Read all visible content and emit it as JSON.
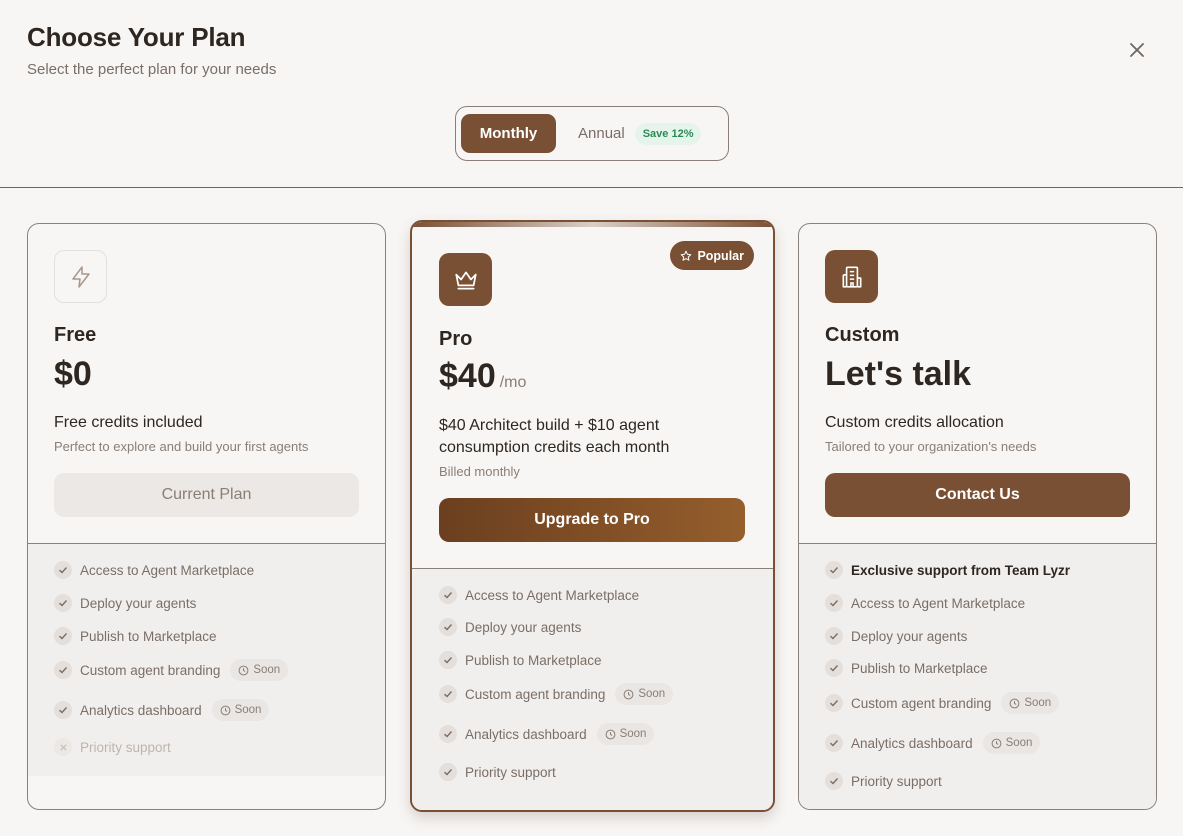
{
  "header": {
    "title": "Choose Your Plan",
    "subtitle": "Select the perfect plan for your needs"
  },
  "icons": {
    "close": "close-icon",
    "free": "lightning-icon",
    "pro": "crown-icon",
    "custom": "building-icon",
    "popular": "star-icon",
    "check": "check-icon",
    "cross": "x-icon",
    "soon": "clock-icon"
  },
  "billing_toggle": {
    "monthly_label": "Monthly",
    "annual_label": "Annual",
    "save_badge": "Save 12%",
    "selected": "Monthly"
  },
  "colors": {
    "accent": "#7a5035",
    "background": "#f8f6f4",
    "save_badge": "#2d8a57"
  },
  "plans": {
    "free": {
      "name": "Free",
      "price": "$0",
      "description": "Free credits included",
      "subtext": "Perfect to explore and build your first agents",
      "cta": "Current Plan",
      "features": [
        {
          "label": "Access to Agent Marketplace"
        },
        {
          "label": "Deploy your agents"
        },
        {
          "label": "Publish to Marketplace"
        },
        {
          "label": "Custom agent branding",
          "badge": "Soon"
        },
        {
          "label": "Analytics dashboard",
          "badge": "Soon"
        },
        {
          "label": "Priority support"
        }
      ]
    },
    "pro": {
      "badge": "Popular",
      "name": "Pro",
      "price": "$40",
      "per": "/mo",
      "description": "$40 Architect build + $10 agent consumption credits each month",
      "subtext": "Billed monthly",
      "cta": "Upgrade to Pro",
      "features": [
        {
          "label": "Access to Agent Marketplace"
        },
        {
          "label": "Deploy your agents"
        },
        {
          "label": "Publish to Marketplace"
        },
        {
          "label": "Custom agent branding",
          "badge": "Soon"
        },
        {
          "label": "Analytics dashboard",
          "badge": "Soon"
        },
        {
          "label": "Priority support"
        }
      ]
    },
    "custom": {
      "name": "Custom",
      "price": "Let's talk",
      "description": "Custom credits allocation",
      "subtext": "Tailored to your organization's needs",
      "cta": "Contact Us",
      "features": [
        {
          "label": "Exclusive support from Team Lyzr"
        },
        {
          "label": "Access to Agent Marketplace"
        },
        {
          "label": "Deploy your agents"
        },
        {
          "label": "Publish to Marketplace"
        },
        {
          "label": "Custom agent branding",
          "badge": "Soon"
        },
        {
          "label": "Analytics dashboard",
          "badge": "Soon"
        },
        {
          "label": "Priority support"
        }
      ]
    }
  }
}
